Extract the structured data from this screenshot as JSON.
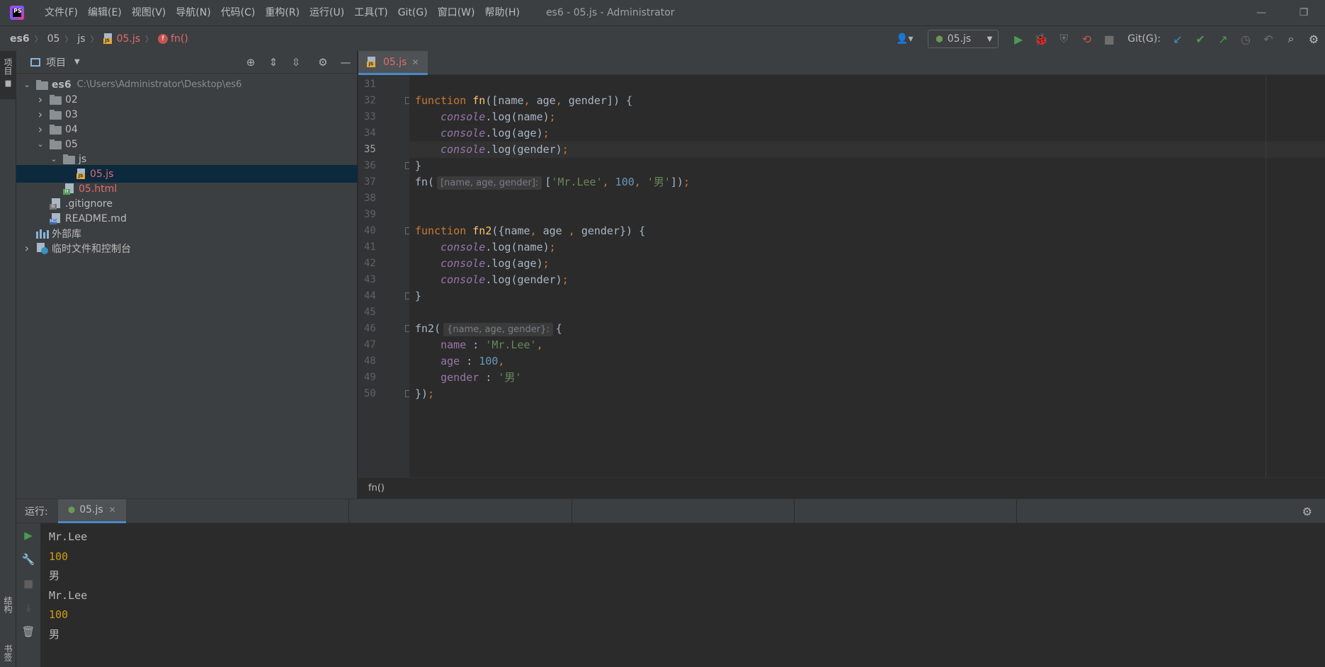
{
  "titlebar": {
    "app_icon": "phpstorm-logo",
    "logo_text": "PS",
    "menu": [
      "文件(F)",
      "编辑(E)",
      "视图(V)",
      "导航(N)",
      "代码(C)",
      "重构(R)",
      "运行(U)",
      "工具(T)",
      "Git(G)",
      "窗口(W)",
      "帮助(H)"
    ],
    "window_title": "es6 - 05.js - Administrator",
    "controls": [
      "minimize-icon",
      "restore-icon"
    ]
  },
  "navbar": {
    "breadcrumb": [
      "es6",
      "05",
      "js",
      "05.js",
      "fn()"
    ],
    "run_config": "05.js",
    "git_label": "Git(G):"
  },
  "left_stripe": {
    "project": "项目",
    "structure": "结构",
    "bookmarks": "书签"
  },
  "project_panel": {
    "title": "项目",
    "tree": [
      {
        "label": "es6",
        "path": "C:\\Users\\Administrator\\Desktop\\es6",
        "type": "folder",
        "level": 0,
        "expanded": true
      },
      {
        "label": "02",
        "type": "folder",
        "level": 1,
        "expanded": false
      },
      {
        "label": "03",
        "type": "folder",
        "level": 1,
        "expanded": false
      },
      {
        "label": "04",
        "type": "folder",
        "level": 1,
        "expanded": false
      },
      {
        "label": "05",
        "type": "folder",
        "level": 1,
        "expanded": true
      },
      {
        "label": "js",
        "type": "folder",
        "level": 2,
        "expanded": true
      },
      {
        "label": "05.js",
        "type": "js",
        "level": 3,
        "selected": true
      },
      {
        "label": "05.html",
        "type": "html",
        "level": 2
      },
      {
        "label": ".gitignore",
        "type": "gitignore",
        "level": 1
      },
      {
        "label": "README.md",
        "type": "md",
        "level": 1
      },
      {
        "label": "外部库",
        "type": "library",
        "level": 0
      },
      {
        "label": "临时文件和控制台",
        "type": "scratch",
        "level": 0,
        "expanded": false
      }
    ]
  },
  "editor": {
    "tab": "05.js",
    "current_line": 35,
    "lines": [
      {
        "n": 31,
        "tokens": []
      },
      {
        "n": 32,
        "tokens": [
          [
            "kw",
            "function "
          ],
          [
            "fnname",
            "fn"
          ],
          [
            "param",
            "([name"
          ],
          [
            "punc",
            ", "
          ],
          [
            "param",
            "age"
          ],
          [
            "punc",
            ", "
          ],
          [
            "param",
            "gender]) {"
          ]
        ]
      },
      {
        "n": 33,
        "tokens": [
          [
            "param",
            "    "
          ],
          [
            "console",
            "console"
          ],
          [
            "param",
            ".log(name)"
          ],
          [
            "punc",
            ";"
          ]
        ]
      },
      {
        "n": 34,
        "tokens": [
          [
            "param",
            "    "
          ],
          [
            "console",
            "console"
          ],
          [
            "param",
            ".log(age)"
          ],
          [
            "punc",
            ";"
          ]
        ]
      },
      {
        "n": 35,
        "tokens": [
          [
            "param",
            "    "
          ],
          [
            "console",
            "console"
          ],
          [
            "param",
            ".log(gender)"
          ],
          [
            "punc",
            ";"
          ]
        ]
      },
      {
        "n": 36,
        "tokens": [
          [
            "param",
            "}"
          ]
        ]
      },
      {
        "n": 37,
        "tokens": [
          [
            "param",
            "fn("
          ],
          [
            "hint",
            "[name, age, gender]:"
          ],
          [
            "param",
            "["
          ],
          [
            "str",
            "'Mr.Lee'"
          ],
          [
            "punc",
            ", "
          ],
          [
            "num",
            "100"
          ],
          [
            "punc",
            ", "
          ],
          [
            "str",
            "'男'"
          ],
          [
            "param",
            "])"
          ],
          [
            "punc",
            ";"
          ]
        ]
      },
      {
        "n": 38,
        "tokens": []
      },
      {
        "n": 39,
        "tokens": []
      },
      {
        "n": 40,
        "tokens": [
          [
            "kw",
            "function "
          ],
          [
            "fnname",
            "fn2"
          ],
          [
            "param",
            "({name"
          ],
          [
            "punc",
            ", "
          ],
          [
            "param",
            "age "
          ],
          [
            "punc",
            ", "
          ],
          [
            "param",
            "gender}) {"
          ]
        ]
      },
      {
        "n": 41,
        "tokens": [
          [
            "param",
            "    "
          ],
          [
            "console",
            "console"
          ],
          [
            "param",
            ".log(name)"
          ],
          [
            "punc",
            ";"
          ]
        ]
      },
      {
        "n": 42,
        "tokens": [
          [
            "param",
            "    "
          ],
          [
            "console",
            "console"
          ],
          [
            "param",
            ".log(age)"
          ],
          [
            "punc",
            ";"
          ]
        ]
      },
      {
        "n": 43,
        "tokens": [
          [
            "param",
            "    "
          ],
          [
            "console",
            "console"
          ],
          [
            "param",
            ".log(gender)"
          ],
          [
            "punc",
            ";"
          ]
        ]
      },
      {
        "n": 44,
        "tokens": [
          [
            "param",
            "}"
          ]
        ]
      },
      {
        "n": 45,
        "tokens": []
      },
      {
        "n": 46,
        "tokens": [
          [
            "param",
            "fn2("
          ],
          [
            "hint",
            "{name, age, gender}:"
          ],
          [
            "param",
            "{"
          ]
        ]
      },
      {
        "n": 47,
        "tokens": [
          [
            "param",
            "    "
          ],
          [
            "prop",
            "name"
          ],
          [
            "param",
            " : "
          ],
          [
            "str",
            "'Mr.Lee'"
          ],
          [
            "punc",
            ","
          ]
        ]
      },
      {
        "n": 48,
        "tokens": [
          [
            "param",
            "    "
          ],
          [
            "prop",
            "age"
          ],
          [
            "param",
            " : "
          ],
          [
            "num",
            "100"
          ],
          [
            "punc",
            ","
          ]
        ]
      },
      {
        "n": 49,
        "tokens": [
          [
            "param",
            "    "
          ],
          [
            "prop",
            "gender"
          ],
          [
            "param",
            " : "
          ],
          [
            "str",
            "'男'"
          ]
        ]
      },
      {
        "n": 50,
        "tokens": [
          [
            "param",
            "})"
          ],
          [
            "punc",
            ";"
          ]
        ]
      }
    ],
    "breadcrumb": "fn()"
  },
  "run_panel": {
    "label": "运行:",
    "tab": "05.js",
    "output": [
      {
        "text": "Mr.Lee",
        "kind": "text"
      },
      {
        "text": "100",
        "kind": "number"
      },
      {
        "text": "男",
        "kind": "text"
      },
      {
        "text": "Mr.Lee",
        "kind": "text"
      },
      {
        "text": "100",
        "kind": "number"
      },
      {
        "text": "男",
        "kind": "text"
      }
    ]
  },
  "colors": {
    "accent": "#4a88c7",
    "run_green": "#499c54",
    "error_red": "#e06c6c",
    "selection": "#0d293e"
  }
}
